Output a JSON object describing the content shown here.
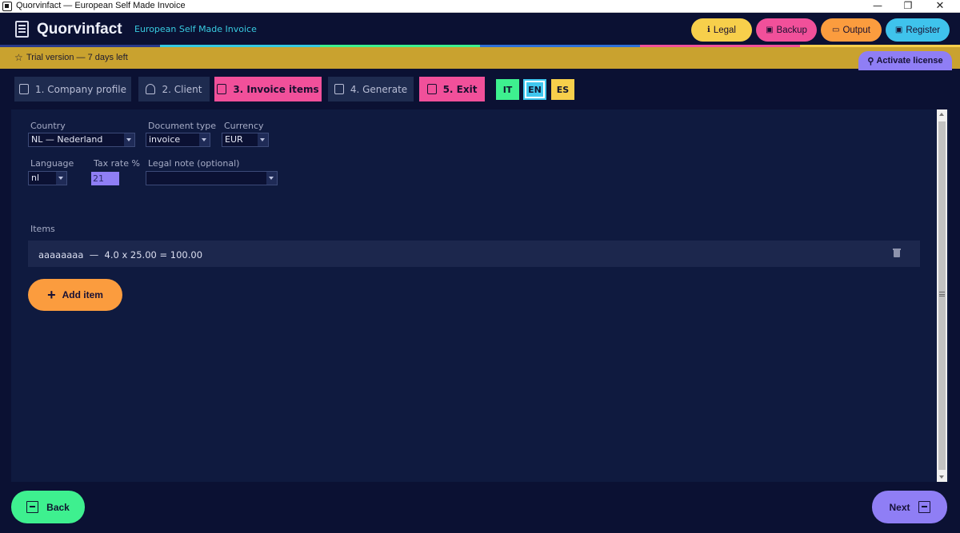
{
  "window": {
    "title": "Quorvinfact — European Self Made Invoice",
    "controls": {
      "minimize": "—",
      "maximize": "❐",
      "close": "✕"
    }
  },
  "header": {
    "brand": "Quorvinfact",
    "tagline": "European Self Made Invoice",
    "buttons": [
      {
        "label": "Legal",
        "icon": "info-icon",
        "color": "#f7cf4b"
      },
      {
        "label": "Backup",
        "icon": "save-icon",
        "color": "#f1509a"
      },
      {
        "label": "Output",
        "icon": "folder-icon",
        "color": "#fb9c3e"
      },
      {
        "label": "Register",
        "icon": "save-icon",
        "color": "#3fc3ec"
      }
    ]
  },
  "trial": {
    "text": "Trial version — 7 days left",
    "activate_label": "Activate license"
  },
  "tabs": [
    {
      "label": "1. Company profile",
      "icon": "building-icon",
      "active": false
    },
    {
      "label": "2. Client",
      "icon": "user-icon",
      "active": false
    },
    {
      "label": "3. Invoice items",
      "icon": "list-icon",
      "active": true
    },
    {
      "label": "4. Generate",
      "icon": "document-icon",
      "active": false
    },
    {
      "label": "5. Exit",
      "icon": "exit-icon",
      "active": true
    }
  ],
  "languages": [
    {
      "code": "IT",
      "color": "#3ef08f",
      "selected": false
    },
    {
      "code": "EN",
      "color": "#40c7ef",
      "selected": true
    },
    {
      "code": "ES",
      "color": "#f7cf4b",
      "selected": false
    }
  ],
  "form": {
    "country": {
      "label": "Country",
      "value": "NL — Nederland"
    },
    "document_type": {
      "label": "Document type",
      "value": "invoice"
    },
    "currency": {
      "label": "Currency",
      "value": "EUR"
    },
    "language": {
      "label": "Language",
      "value": "nl"
    },
    "tax_rate": {
      "label": "Tax rate %",
      "value": "21"
    },
    "legal_note": {
      "label": "Legal note (optional)",
      "value": ""
    }
  },
  "items": {
    "label": "Items",
    "rows": [
      {
        "text": "aaaaaaaa  —  4.0 x 25.00 = 100.00"
      }
    ],
    "add_label": "Add item"
  },
  "footer": {
    "back_label": "Back",
    "next_label": "Next"
  },
  "colors": {
    "background": "#0b1133",
    "panel": "#0f1a3f",
    "pink": "#f1509a",
    "orange": "#fb9c3e",
    "green": "#3ef08f",
    "purple": "#8f7ef5",
    "cyan": "#40c7ef",
    "yellow": "#f7cf4b",
    "trial_bar": "#c9a22f"
  }
}
